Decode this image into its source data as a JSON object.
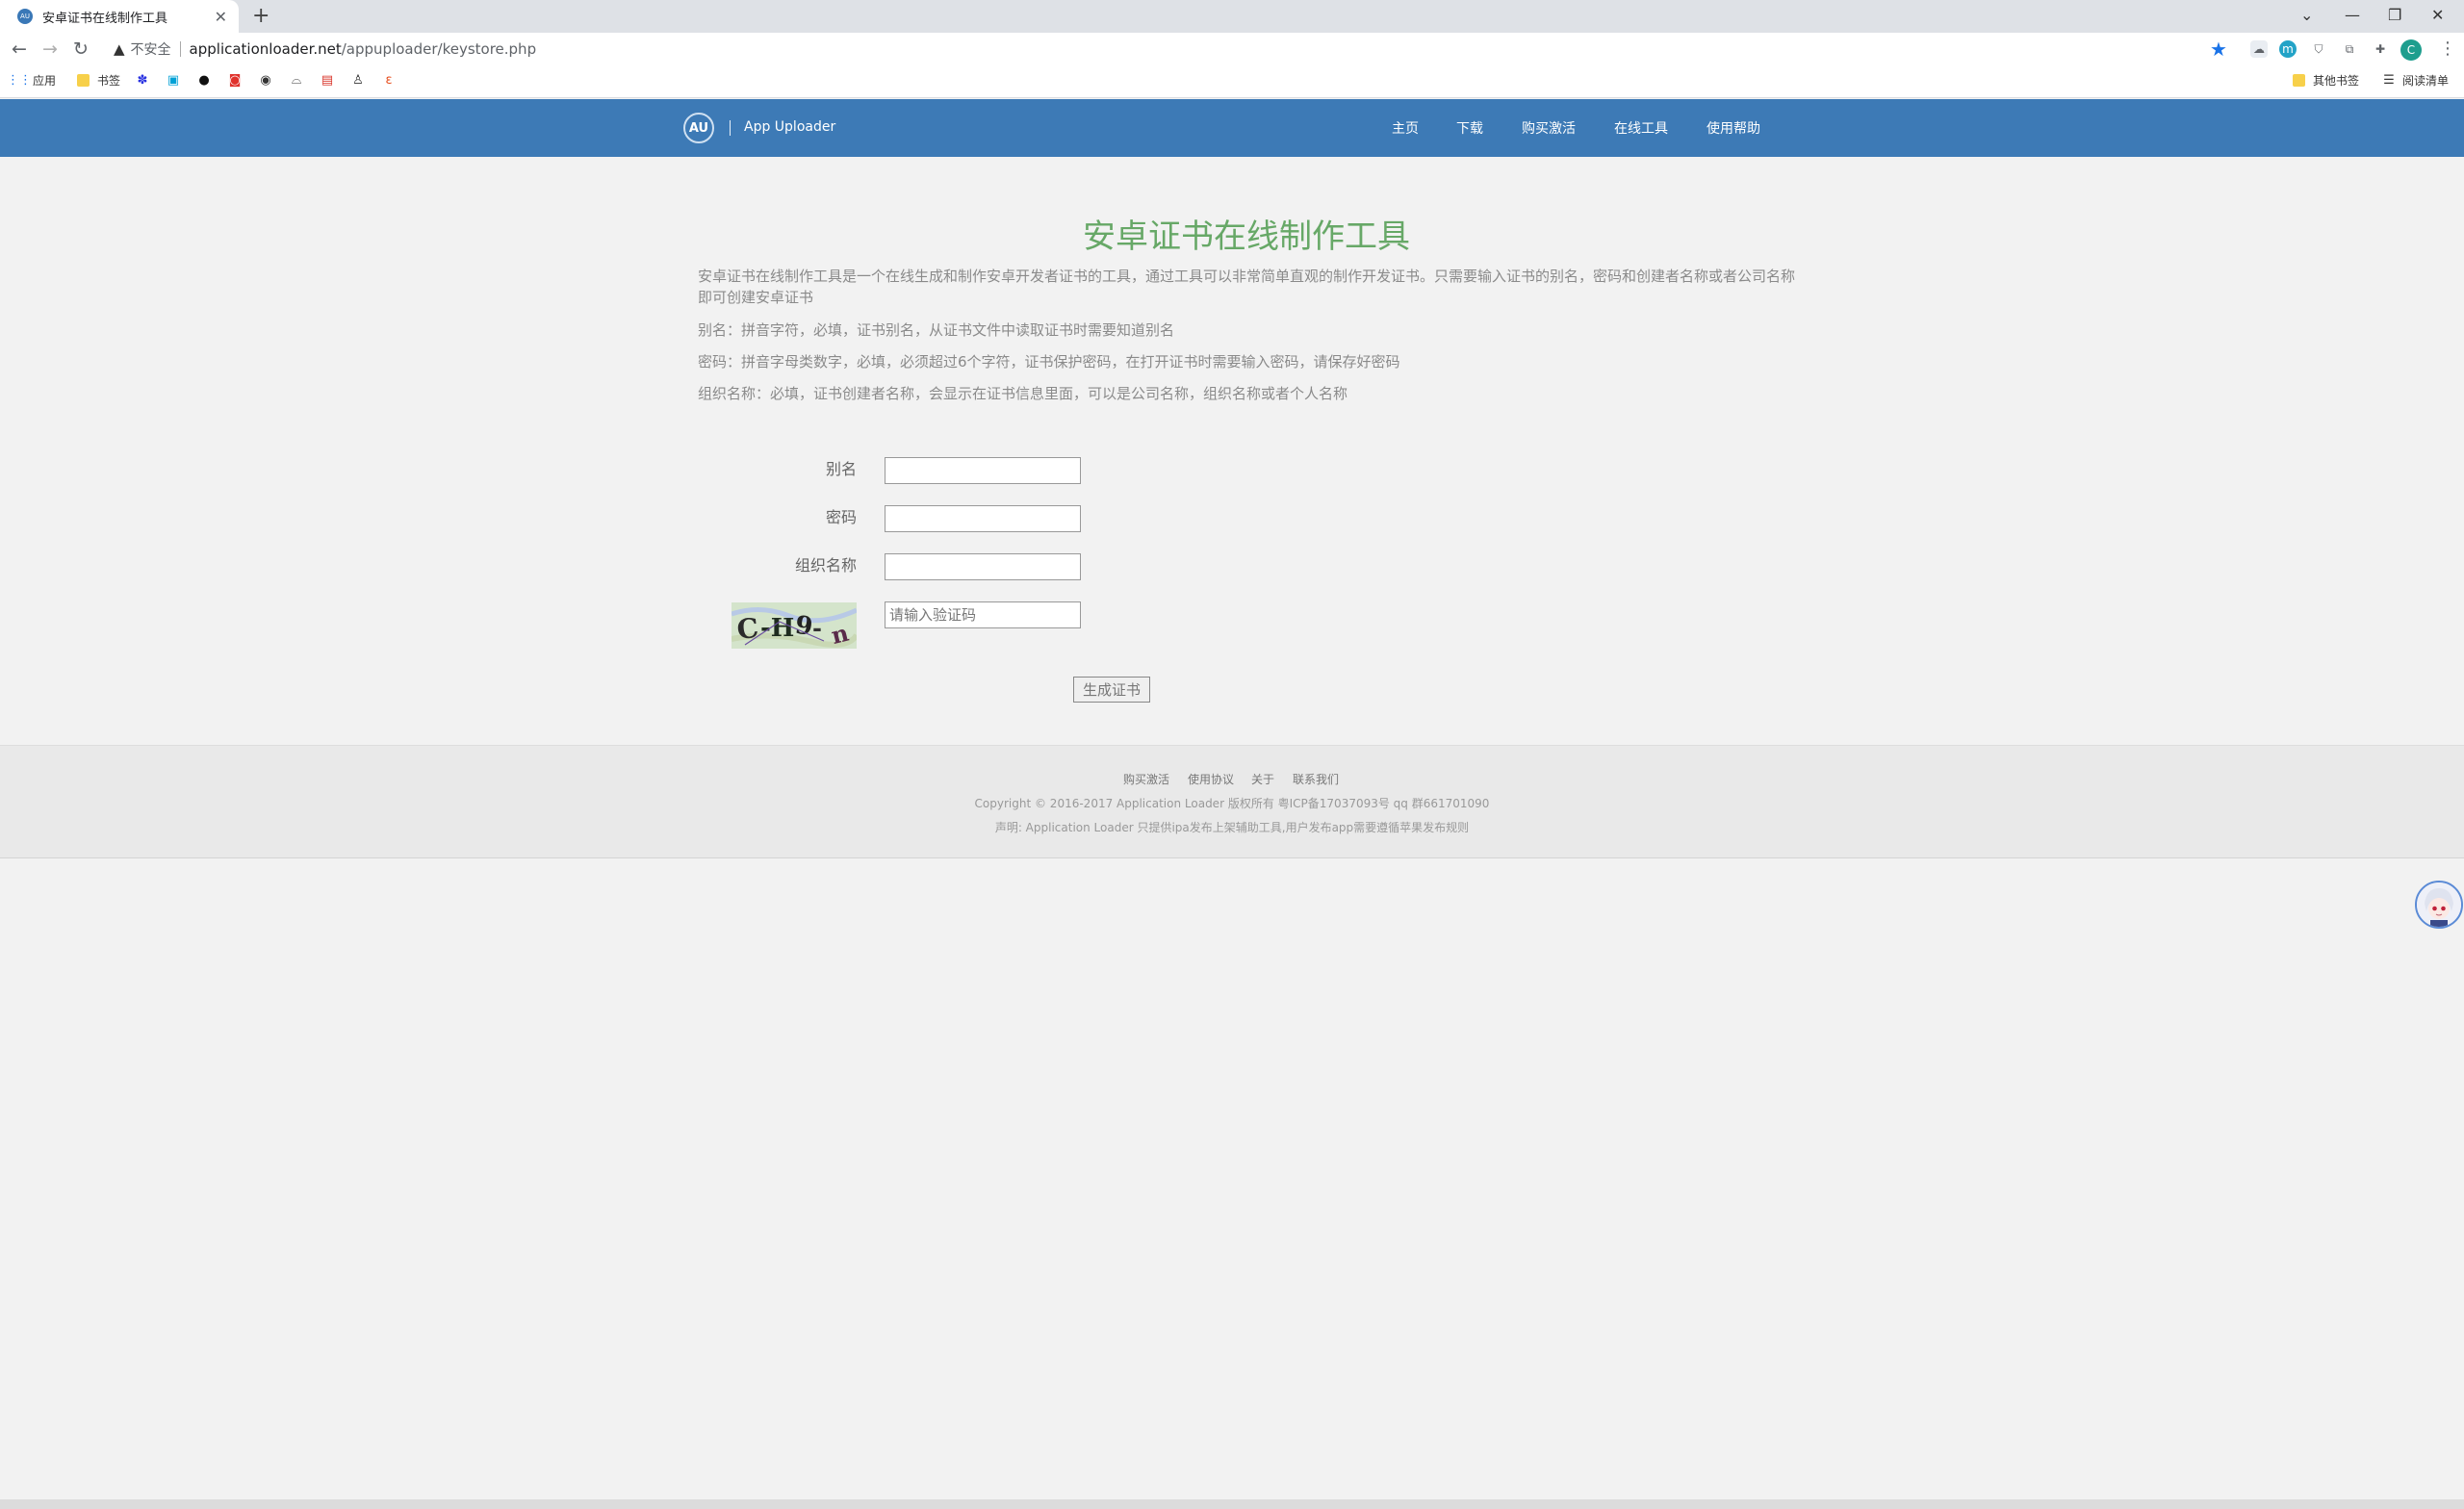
{
  "browser": {
    "tab_title": "安卓证书在线制作工具",
    "tab_favicon_text": "AU",
    "new_tab_icon": "+",
    "insecure_label": "不安全",
    "url_host": "applicationloader.net",
    "url_path": "/appuploader/keystore.php",
    "profile_initial": "C",
    "bookmarks": {
      "apps": "应用",
      "folder": "书签",
      "other": "其他书签",
      "reading_list": "阅读清单"
    }
  },
  "header": {
    "logo_text": "AU",
    "brand": "App Uploader",
    "nav": [
      "主页",
      "下载",
      "购买激活",
      "在线工具",
      "使用帮助"
    ]
  },
  "main": {
    "title": "安卓证书在线制作工具",
    "description": [
      "安卓证书在线制作工具是一个在线生成和制作安卓开发者证书的工具，通过工具可以非常简单直观的制作开发证书。只需要输入证书的别名，密码和创建者名称或者公司名称即可创建安卓证书",
      "别名：拼音字符，必填，证书别名，从证书文件中读取证书时需要知道别名",
      "密码：拼音字母类数字，必填，必须超过6个字符，证书保护密码，在打开证书时需要输入密码，请保存好密码",
      "组织名称：必填，证书创建者名称，会显示在证书信息里面，可以是公司名称，组织名称或者个人名称"
    ],
    "form": {
      "alias_label": "别名",
      "password_label": "密码",
      "org_label": "组织名称",
      "captcha_text": "CH9n",
      "captcha_placeholder": "请输入验证码",
      "submit_label": "生成证书"
    }
  },
  "footer": {
    "links": [
      "购买激活",
      "使用协议",
      "关于",
      "联系我们"
    ],
    "copyright": "Copyright © 2016-2017 Application Loader 版权所有 粤ICP备17037093号 qq 群661701090",
    "notice": "声明: Application Loader 只提供ipa发布上架辅助工具,用户发布app需要遵循苹果发布规则"
  },
  "colors": {
    "header_bg": "#3d7ab6",
    "title_green": "#67a867",
    "page_bg": "#f2f2f2"
  }
}
